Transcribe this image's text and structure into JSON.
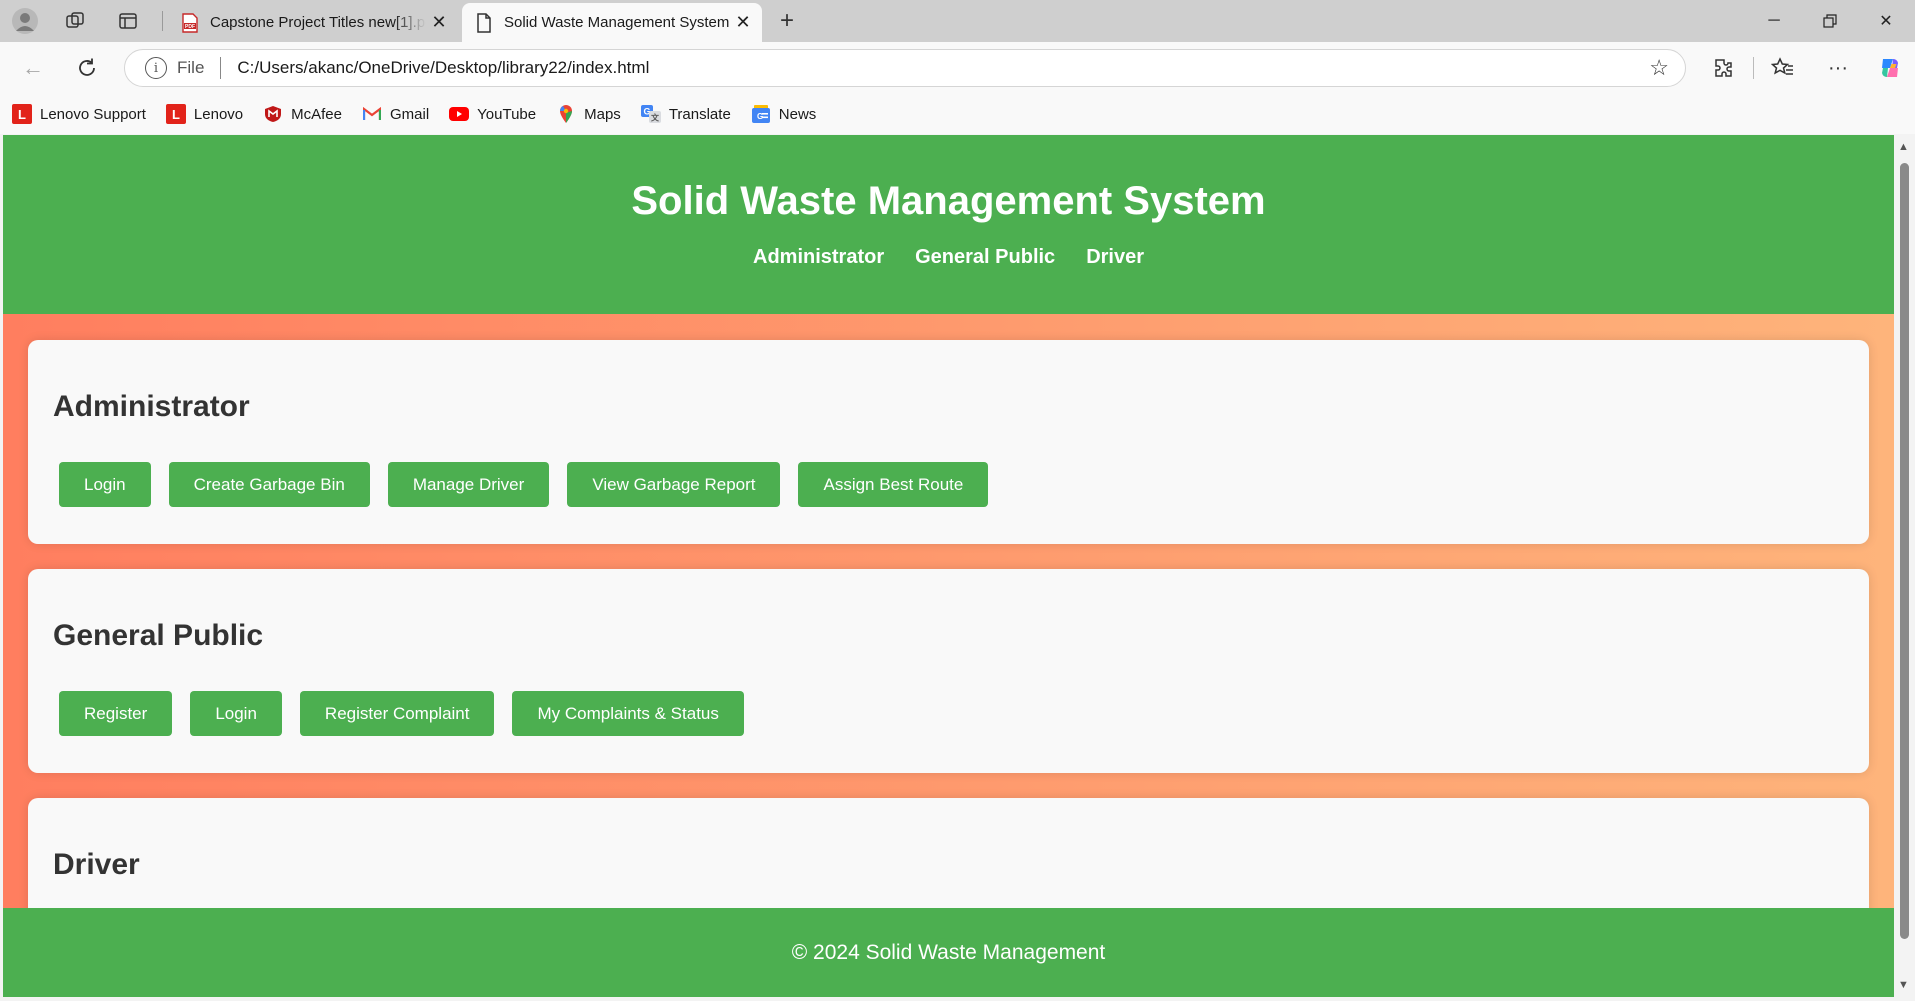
{
  "browser": {
    "tabs": [
      {
        "title": "Capstone Project Titles new[1].pdf",
        "icon": "pdf-icon"
      },
      {
        "title": "Solid Waste Management System",
        "icon": "page-icon"
      }
    ],
    "address": {
      "scheme": "File",
      "url": "C:/Users/akanc/OneDrive/Desktop/library22/index.html"
    },
    "bookmarks": [
      {
        "label": "Lenovo Support",
        "icon": "lenovo-icon"
      },
      {
        "label": "Lenovo",
        "icon": "lenovo-icon"
      },
      {
        "label": "McAfee",
        "icon": "mcafee-icon"
      },
      {
        "label": "Gmail",
        "icon": "gmail-icon"
      },
      {
        "label": "YouTube",
        "icon": "youtube-icon"
      },
      {
        "label": "Maps",
        "icon": "maps-icon"
      },
      {
        "label": "Translate",
        "icon": "translate-icon"
      },
      {
        "label": "News",
        "icon": "news-icon"
      }
    ]
  },
  "site": {
    "title": "Solid Waste Management System",
    "nav": [
      "Administrator",
      "General Public",
      "Driver"
    ],
    "sections": [
      {
        "heading": "Administrator",
        "buttons": [
          "Login",
          "Create Garbage Bin",
          "Manage Driver",
          "View Garbage Report",
          "Assign Best Route"
        ]
      },
      {
        "heading": "General Public",
        "buttons": [
          "Register",
          "Login",
          "Register Complaint",
          "My Complaints & Status"
        ]
      },
      {
        "heading": "Driver",
        "buttons": []
      }
    ],
    "footer": "© 2024 Solid Waste Management"
  },
  "colors": {
    "primary_green": "#4caf50",
    "gradient_start": "#ff7e5f",
    "gradient_end": "#feb47b",
    "card_background": "#f9f9f9",
    "heading_text": "#333333"
  }
}
